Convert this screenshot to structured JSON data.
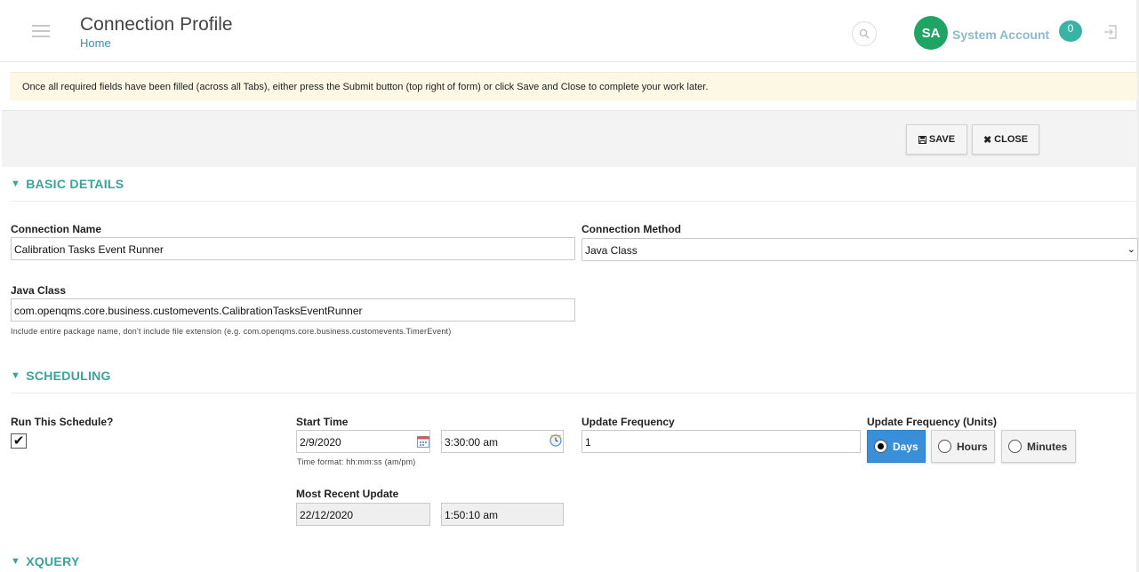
{
  "header": {
    "title": "Connection Profile",
    "breadcrumb": "Home",
    "user_initials": "SA",
    "user_name": "System Account",
    "notification_count": "0",
    "avatar_color": "#1fa463"
  },
  "banner": {
    "message": "Once all required fields have been filled (across all Tabs), either press the Submit button (top right of form) or click Save and Close to complete your work later."
  },
  "toolbar": {
    "save_label": "SAVE",
    "close_label": "CLOSE"
  },
  "basic_details": {
    "heading": "BASIC DETAILS",
    "connection_name_label": "Connection Name",
    "connection_name_value": "Calibration Tasks Event Runner",
    "connection_method_label": "Connection Method",
    "connection_method_value": "Java Class",
    "java_class_label": "Java Class",
    "java_class_value": "com.openqms.core.business.customevents.CalibrationTasksEventRunner",
    "java_class_hint": "Include entire package name, don't include file extension (e.g. com.openqms.core.business.customevents.TimerEvent)"
  },
  "scheduling": {
    "heading": "SCHEDULING",
    "run_schedule_label": "Run This Schedule?",
    "run_schedule_checked": true,
    "start_time_label": "Start Time",
    "start_date_value": "2/9/2020",
    "start_time_value": "3:30:00 am",
    "time_format_hint": "Time format: hh:mm:ss (am/pm)",
    "update_frequency_label": "Update Frequency",
    "update_frequency_value": "1",
    "update_units_label": "Update Frequency (Units)",
    "units": [
      {
        "label": "Days",
        "selected": true
      },
      {
        "label": "Hours",
        "selected": false
      },
      {
        "label": "Minutes",
        "selected": false
      }
    ],
    "most_recent_label": "Most Recent Update",
    "most_recent_date": "22/12/2020",
    "most_recent_time": "1:50:10 am"
  },
  "xquery": {
    "heading": "XQUERY"
  },
  "colors": {
    "section_accent": "#3aa39a",
    "selected_unit": "#3a8fd9",
    "banner_bg": "#fcf8e3"
  }
}
